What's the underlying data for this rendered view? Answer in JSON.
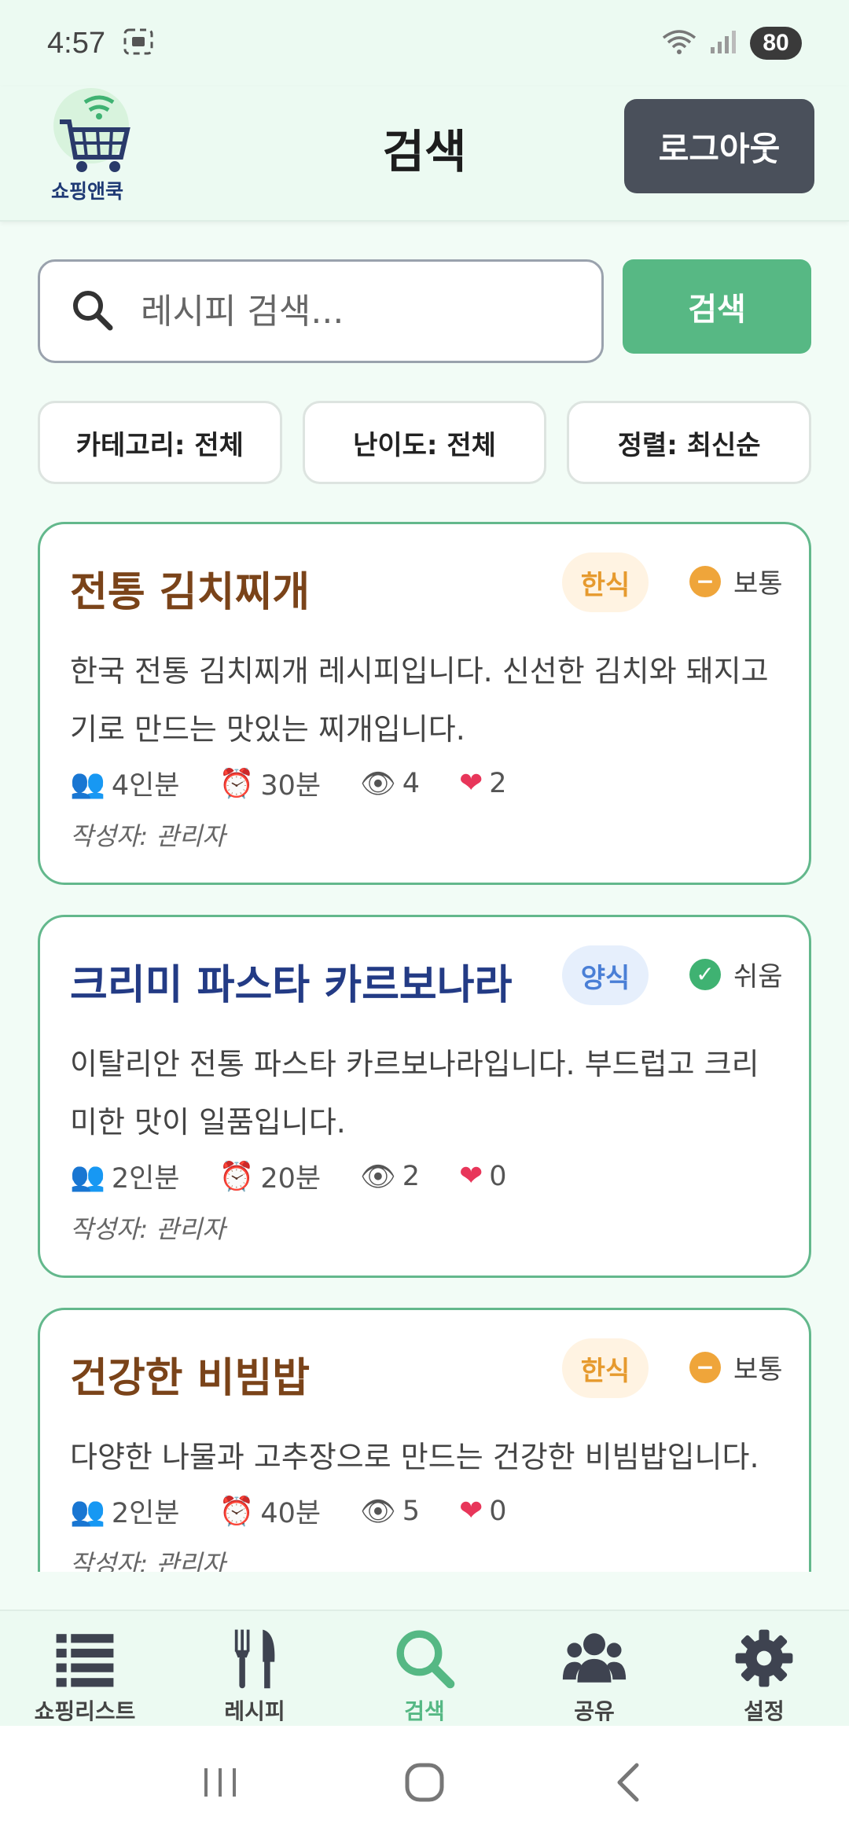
{
  "status_bar": {
    "time": "4:57",
    "battery": "80"
  },
  "header": {
    "logo_text": "쇼핑앤쿡",
    "title": "검색",
    "logout_label": "로그아웃"
  },
  "search": {
    "placeholder": "레시피 검색...",
    "button_label": "검색"
  },
  "filters": [
    {
      "label": "카테고리: 전체"
    },
    {
      "label": "난이도: 전체"
    },
    {
      "label": "정렬: 최신순"
    }
  ],
  "recipes": [
    {
      "title": "전통 김치찌개",
      "category": "한식",
      "difficulty": "보통",
      "description": "한국 전통 김치찌개 레시피입니다. 신선한 김치와 돼지고기로 만드는 맛있는 찌개입니다.",
      "servings": "4인분",
      "time": "30분",
      "views": "4",
      "likes": "2",
      "author": "작성자: 관리자"
    },
    {
      "title": "크리미 파스타 카르보나라",
      "category": "양식",
      "difficulty": "쉬움",
      "description": "이탈리안 전통 파스타 카르보나라입니다. 부드럽고 크리미한 맛이 일품입니다.",
      "servings": "2인분",
      "time": "20분",
      "views": "2",
      "likes": "0",
      "author": "작성자: 관리자"
    },
    {
      "title": "건강한 비빔밥",
      "category": "한식",
      "difficulty": "보통",
      "description": "다양한 나물과 고추장으로 만드는 건강한 비빔밥입니다.",
      "servings": "2인분",
      "time": "40분",
      "views": "5",
      "likes": "0",
      "author": "작성자: 관리자"
    }
  ],
  "bottom_nav": [
    {
      "label": "쇼핑리스트",
      "icon": "list-icon"
    },
    {
      "label": "레시피",
      "icon": "utensils-icon"
    },
    {
      "label": "검색",
      "icon": "search-icon",
      "active": true
    },
    {
      "label": "공유",
      "icon": "users-icon"
    },
    {
      "label": "설정",
      "icon": "gear-icon"
    }
  ],
  "colors": {
    "accent": "#57b884",
    "korean_title": "#7a4319",
    "western_title": "#233b85",
    "logout_bg": "#4a505b"
  }
}
